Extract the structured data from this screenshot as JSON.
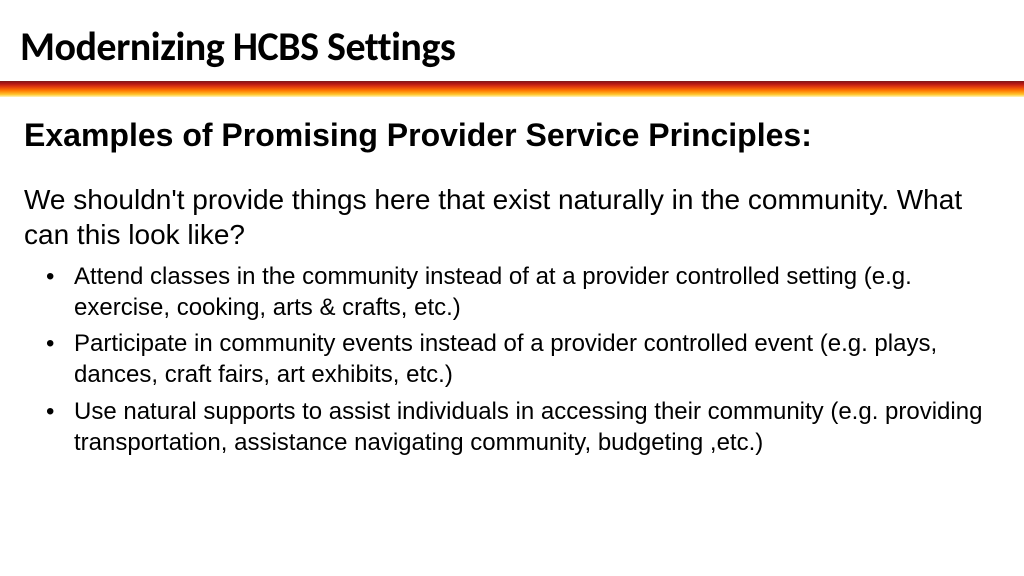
{
  "header": {
    "title": "Modernizing HCBS Settings"
  },
  "main": {
    "subtitle": "Examples of Promising Provider Service Principles:",
    "intro": "We shouldn't provide things here that exist naturally in the community.  What can this look like?",
    "bullets": [
      "Attend classes in the community instead of at a provider controlled setting (e.g. exercise, cooking, arts & crafts, etc.)",
      "Participate in community events instead of a provider controlled event (e.g. plays, dances, craft fairs, art exhibits, etc.)",
      "Use natural supports to assist individuals in accessing their community (e.g. providing transportation, assistance navigating community, budgeting ,etc.)"
    ]
  }
}
